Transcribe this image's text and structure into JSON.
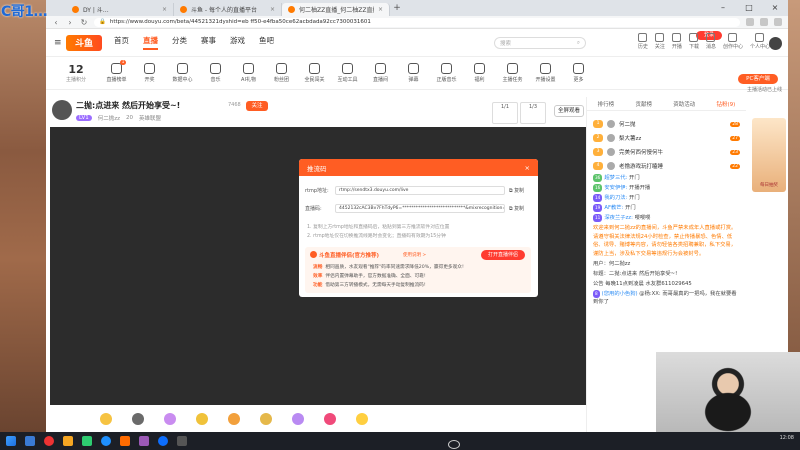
{
  "overlay_title": "C哥1…",
  "browser": {
    "tabs": [
      {
        "label": "DY | 斗…",
        "active": false
      },
      {
        "label": "斗鱼 - 每个人的直播平台",
        "active": false
      },
      {
        "label": "何二柚ZZ直播_何二柚ZZ直播视...",
        "active": true
      }
    ],
    "new_tab": "+",
    "url": "https://www.douyu.com/beta/44521321dyshid=eb ff50-e4fba50ce62acbdada92cc7300031601"
  },
  "site": {
    "logo": "斗鱼",
    "nav": [
      "首页",
      "直播",
      "分类",
      "赛事",
      "游戏",
      "鱼吧"
    ],
    "active_nav": "直播",
    "search_placeholder": "搜索",
    "header_icons": [
      "历史",
      "关注",
      "开播",
      "下载",
      "消息",
      "创作中心",
      "个人中心"
    ],
    "badge": "登录"
  },
  "categories": {
    "count": "12",
    "count_label": "主播积分",
    "items": [
      {
        "label": "直播榜单",
        "badge": "1"
      },
      {
        "label": "开奖",
        "badge": ""
      },
      {
        "label": "数据中心",
        "badge": ""
      },
      {
        "label": "音乐",
        "badge": ""
      },
      {
        "label": "AI礼物",
        "badge": ""
      },
      {
        "label": "粉丝团",
        "badge": ""
      },
      {
        "label": "全民闯关",
        "badge": ""
      },
      {
        "label": "互动工具",
        "badge": ""
      },
      {
        "label": "直播间",
        "badge": ""
      },
      {
        "label": "弹幕",
        "badge": ""
      },
      {
        "label": "正版音乐",
        "badge": ""
      },
      {
        "label": "福利",
        "badge": ""
      },
      {
        "label": "主播任务",
        "badge": ""
      },
      {
        "label": "开播设置",
        "badge": ""
      },
      {
        "label": "更多",
        "badge": ""
      }
    ],
    "pc_button": "PC客户端",
    "pc_sub": "主播活动已上线"
  },
  "stream": {
    "title": "二抛:点进来 然后开始享受~!",
    "level": "LV1",
    "streamer": "何二抛zz",
    "followers": "20",
    "category": "英雄联盟",
    "hot": "7468",
    "follow": "关注",
    "box1": "1/1",
    "box2": "1/3",
    "fullscreen": "全屏观看"
  },
  "modal": {
    "title": "推流码",
    "close": "×",
    "rtmp_label": "rtmp地址:",
    "rtmp_value": "rtmp://sendtx3.douyu.com/live",
    "key_label": "直播码:",
    "key_value": "4452132cAC3Bv7FhTdyP6=****************************&mixrecognition=",
    "copy": "复制",
    "note1": "1. 复制上方rtmp地址和直播码后，粘贴到第三方推流软件对应位置",
    "note2": "2. rtmp地址仅在切换推流线路时会变化；直播码有效期为15分钟",
    "promo_title": "斗鱼直播伴侣(官方推荐)",
    "promo_link": "使用说明 >",
    "promo_btn": "打开直播伴侣",
    "lines": [
      {
        "tag": "流畅",
        "text": "相同画质，水友观看\"推荐\"码率同速需求降低20%，赢得更多观众!"
      },
      {
        "tag": "效率",
        "text": "伴侣内置弹幕助手，官方数据准确、全面、可靠!"
      },
      {
        "tag": "功能",
        "text": "借助第三方转播模式，无需每天手动复制推流码!"
      }
    ]
  },
  "chat": {
    "tabs": [
      "排行榜",
      "贡献榜",
      "资助活动",
      "钻粉(9)"
    ],
    "active_tab": "钻粉(9)",
    "rank": [
      {
        "n": "1",
        "name": "何二抛",
        "lv": "28"
      },
      {
        "n": "2",
        "name": "梨大薯zz",
        "lv": "27"
      },
      {
        "n": "3",
        "name": "完美何西何慢何牛",
        "lv": "23"
      },
      {
        "n": "4",
        "name": "老撸游戏玩打瞌睡",
        "lv": "22"
      }
    ],
    "messages": [
      {
        "tag": "36",
        "user": "超梦三代:",
        "text": "开门"
      },
      {
        "tag": "16",
        "user": "安安伊伊:",
        "text": "开播开播"
      },
      {
        "tag": "14",
        "user": "我的刀法:",
        "text": "开门"
      },
      {
        "tag": "19",
        "user": "AF教芒:",
        "text": "开门"
      },
      {
        "tag": "11",
        "user": "深夜兰子zz:",
        "text": "嘤嘤嘤"
      }
    ],
    "notice": "欢迎来到何二抛zz的直播间，斗鱼严禁未成年人直播或打赏。请遵守相关法律法规24小时检查，禁止传播暴恐、色情、低俗、诱导、赌博等内容，请勿轻信各类招聘兼职，私下交易，谨防上当，涉及私下交易等违规行为会被封号。",
    "announce": [
      "用户：何二抛zz",
      "标题：二抛:点进来 然后开始享受~!",
      "公告 每晚11点到凌晨 水友群611029645"
    ],
    "last_msg": {
      "tag": "8",
      "user": "(您用的小色狗)",
      "text": "@杨:XX: 而哥最真的一把吗，我在就要看到你了"
    }
  },
  "sidead": {
    "label": "每日抽奖"
  },
  "taskbar": {
    "tray": "12:08"
  }
}
